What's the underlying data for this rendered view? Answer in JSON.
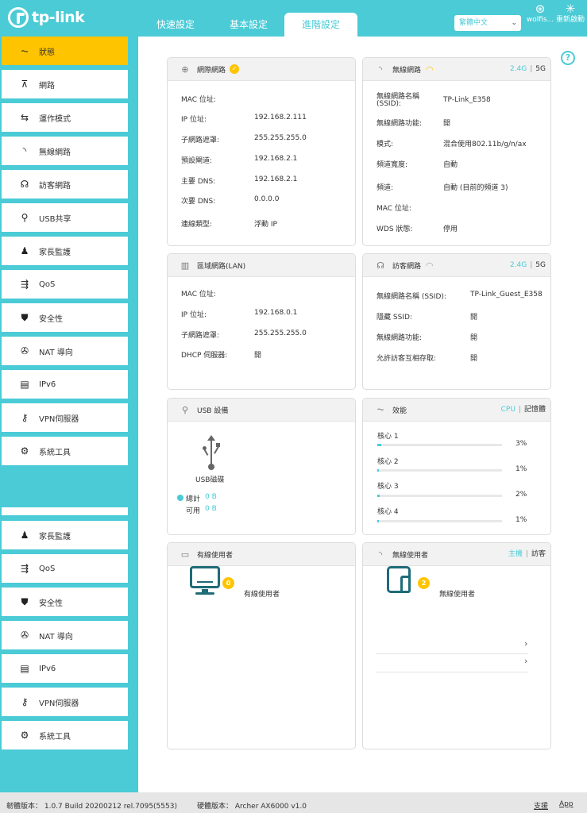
{
  "header": {
    "logo_text": "tp-link",
    "tabs": [
      {
        "label": "快速設定"
      },
      {
        "label": "基本設定"
      },
      {
        "label": "進階設定"
      }
    ],
    "language": "繁體中文",
    "user_label": "wolfis...",
    "reboot_label": "重新啟動"
  },
  "sidebar": {
    "items": [
      {
        "label": "狀態",
        "icon": "pulse-icon"
      },
      {
        "label": "網路",
        "icon": "network-icon"
      },
      {
        "label": "運作模式",
        "icon": "mode-icon"
      },
      {
        "label": "無線網路",
        "icon": "wireless-icon"
      },
      {
        "label": "訪客網路",
        "icon": "guest-icon"
      },
      {
        "label": "USB共享",
        "icon": "usb-icon"
      },
      {
        "label": "家長監護",
        "icon": "parental-icon"
      },
      {
        "label": "QoS",
        "icon": "qos-icon"
      },
      {
        "label": "安全性",
        "icon": "shield-icon"
      },
      {
        "label": "NAT 導向",
        "icon": "nat-icon"
      },
      {
        "label": "IPv6",
        "icon": "ipv6-icon"
      },
      {
        "label": "VPN伺服器",
        "icon": "vpn-icon"
      },
      {
        "label": "系統工具",
        "icon": "gear-icon"
      }
    ],
    "items2": [
      {
        "label": "家長監護"
      },
      {
        "label": "QoS"
      },
      {
        "label": "安全性"
      },
      {
        "label": "NAT 導向"
      },
      {
        "label": "IPv6"
      },
      {
        "label": "VPN伺服器"
      },
      {
        "label": "系統工具"
      }
    ]
  },
  "internet": {
    "title": "網際網路",
    "rows": [
      {
        "k": "MAC 位址:",
        "v": ""
      },
      {
        "k": "IP 位址:",
        "v": "192.168.2.111"
      },
      {
        "k": "子網路遮罩:",
        "v": "255.255.255.0"
      },
      {
        "k": "預設閘道:",
        "v": "192.168.2.1"
      },
      {
        "k": "主要 DNS:",
        "v": "192.168.2.1"
      },
      {
        "k": "次要 DNS:",
        "v": "0.0.0.0"
      },
      {
        "k": "連線類型:",
        "v": "浮動 IP"
      }
    ]
  },
  "wireless": {
    "title": "無線網路",
    "band_24": "2.4G",
    "band_5": "5G",
    "sep": "|",
    "rows": [
      {
        "k": "無線網路名稱",
        "v": "TP-Link_E358"
      },
      {
        "k": "(SSID):",
        "v": ""
      },
      {
        "k": "無線網路功能:",
        "v": "開"
      },
      {
        "k": "模式:",
        "v": "混合使用802.11b/g/n/ax"
      },
      {
        "k": "頻道寬度:",
        "v": "自動"
      },
      {
        "k": "頻道:",
        "v": "自動 (目前的頻道 3)"
      },
      {
        "k": "MAC 位址:",
        "v": ""
      },
      {
        "k": "WDS 狀態:",
        "v": "停用"
      }
    ]
  },
  "lan": {
    "title": "區域網路(LAN)",
    "rows": [
      {
        "k": "MAC 位址:",
        "v": ""
      },
      {
        "k": "IP 位址:",
        "v": "192.168.0.1"
      },
      {
        "k": "子網路遮罩:",
        "v": "255.255.255.0"
      },
      {
        "k": "DHCP 伺服器:",
        "v": "開"
      }
    ]
  },
  "guest": {
    "title": "訪客網路",
    "band_24": "2.4G",
    "band_5": "5G",
    "sep": "|",
    "rows": [
      {
        "k": "無線網路名稱 (SSID):",
        "v": "TP-Link_Guest_E358"
      },
      {
        "k": "隱藏 SSID:",
        "v": "開"
      },
      {
        "k": "無線網路功能:",
        "v": "開"
      },
      {
        "k": "允許訪客互相存取:",
        "v": "開"
      }
    ]
  },
  "usb": {
    "title": "USB 設備",
    "disk_label": "USB磁碟",
    "total_label": "總計",
    "total_value": "0 B",
    "avail_label": "可用",
    "avail_value": "0 B"
  },
  "performance": {
    "title": "效能",
    "cpu_label": "CPU",
    "mem_label": "記憶體",
    "sep": "|",
    "cores": [
      {
        "label": "核心 1",
        "value": "3%",
        "pct": 3
      },
      {
        "label": "核心 2",
        "value": "1%",
        "pct": 1
      },
      {
        "label": "核心 3",
        "value": "2%",
        "pct": 2
      },
      {
        "label": "核心 4",
        "value": "1%",
        "pct": 1
      }
    ]
  },
  "wired_clients": {
    "title": "有線使用者",
    "count": "0",
    "label": "有線使用者"
  },
  "wireless_clients": {
    "title": "無線使用者",
    "host_label": "主機",
    "guest_label": "訪客",
    "sep": "|",
    "count": "2",
    "label": "無線使用者"
  },
  "footer": {
    "firmware": "韌體版本： 1.0.7 Build 20200212 rel.7095(5553)",
    "hardware": "硬體版本： Archer AX6000 v1.0",
    "support": "支援",
    "app": "App"
  },
  "colors": {
    "accent": "#4acbd6",
    "active": "#ffc400"
  }
}
